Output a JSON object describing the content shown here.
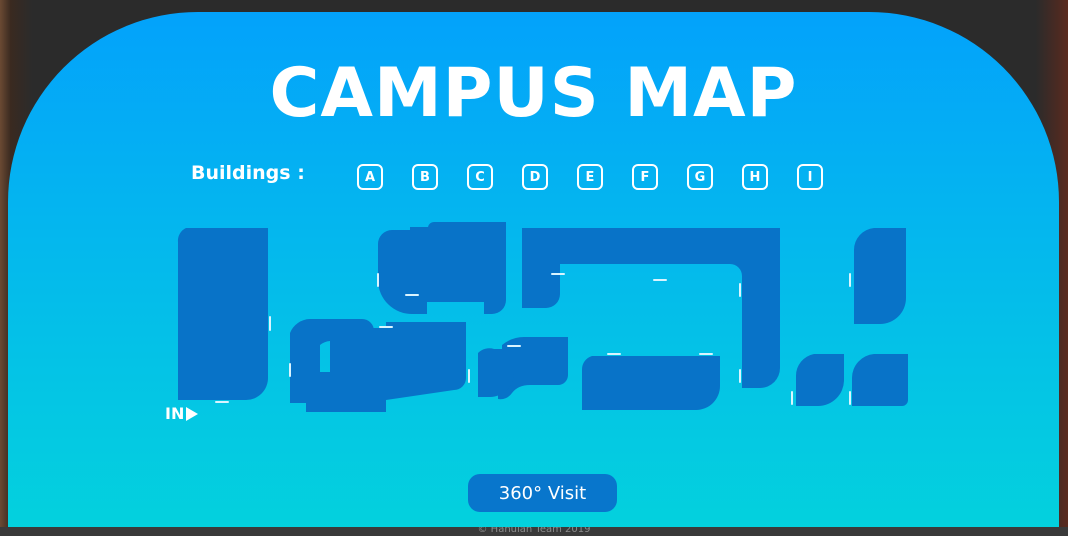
{
  "title": "CAMPUS MAP",
  "buildings_label": "Buildings :",
  "buildings": [
    "A",
    "B",
    "C",
    "D",
    "E",
    "F",
    "G",
    "H",
    "I"
  ],
  "entrance_label": "IN",
  "visit_button": "360° Visit",
  "footer": "© Hahuiah Team 2019",
  "colors": {
    "panel_top": "#03a2fb",
    "panel_bottom": "#03d3dc",
    "building": "#0873c8",
    "button": "#0876cc",
    "text": "#ffffff"
  }
}
